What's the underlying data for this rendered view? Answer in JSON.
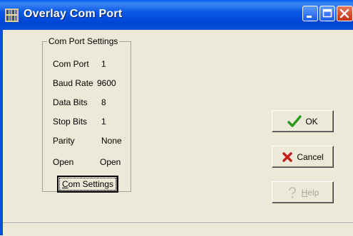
{
  "window": {
    "title": "Overlay Com Port"
  },
  "group": {
    "legend": "Com Port Settings",
    "rows": [
      {
        "label": "Com Port",
        "value": "1"
      },
      {
        "label": "Baud Rate",
        "value": "9600"
      },
      {
        "label": "Data Bits",
        "value": "8"
      },
      {
        "label": "Stop Bits",
        "value": "1"
      },
      {
        "label": "Parity",
        "value": "None"
      },
      {
        "label": "Open",
        "value": "Open"
      }
    ],
    "com_settings_button": {
      "accel": "C",
      "rest": "om Settings"
    }
  },
  "buttons": {
    "ok": "OK",
    "cancel": "Cancel",
    "help": {
      "accel": "H",
      "rest": "elp"
    }
  },
  "colors": {
    "titlebar": "#0046d5",
    "ok_check": "#2a9b1e",
    "cancel_x": "#c0201a",
    "disabled_text": "#a8a59c"
  },
  "icons": {
    "ok": "checkmark-icon",
    "cancel": "red-x-icon",
    "help": "question-mark-icon"
  }
}
